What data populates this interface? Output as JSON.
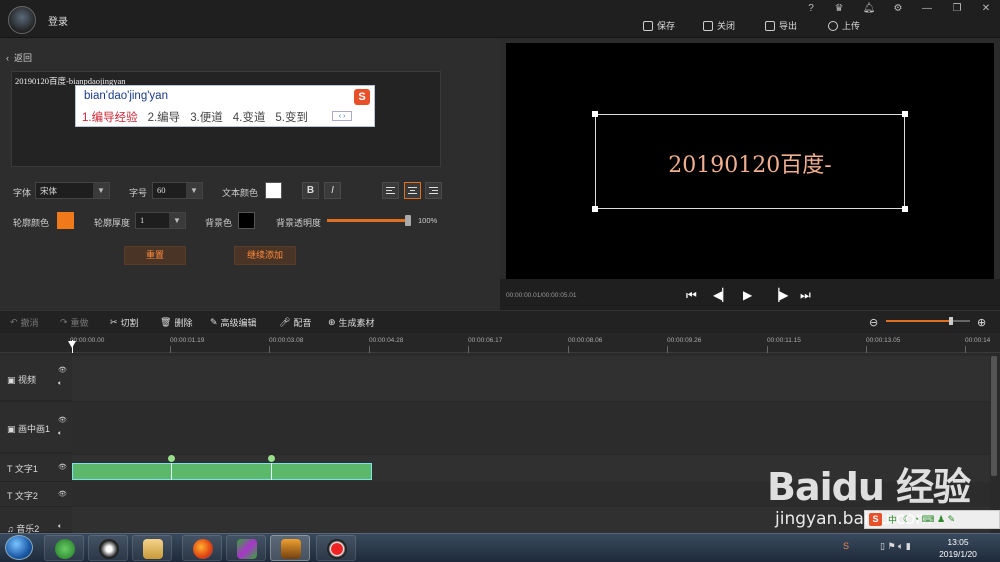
{
  "topbar": {
    "login": "登录",
    "actions": [
      {
        "label": "保存",
        "icon": "save-icon"
      },
      {
        "label": "关闭",
        "icon": "close-icon"
      },
      {
        "label": "导出",
        "icon": "export-icon"
      },
      {
        "label": "上传",
        "icon": "upload-icon"
      }
    ],
    "window_icons": [
      "help-icon",
      "vip-icon",
      "bell-icon",
      "gear-icon",
      "minimize-icon",
      "restore-icon",
      "close-window-icon"
    ],
    "help_glyph": "?"
  },
  "editor": {
    "back_label": "返回",
    "text_value": "20190120百度-bianpdaojingyan",
    "ime": {
      "pinyin": "bian'dao'jing'yan",
      "candidates": [
        "1.编导经验",
        "2.编导",
        "3.便道",
        "4.变道",
        "5.变到"
      ],
      "logo": "S"
    },
    "font_label": "字体",
    "font_value": "宋体",
    "size_label": "字号",
    "size_value": "60",
    "text_color_label": "文本颜色",
    "text_color": "#ffffff",
    "bold": "B",
    "italic": "I",
    "outline_color_label": "轮廓颜色",
    "outline_color": "#f07a1a",
    "outline_width_label": "轮廓厚度",
    "outline_width_value": "1",
    "bg_color_label": "背景色",
    "bg_color": "#000000",
    "bg_opacity_label": "背景透明度",
    "bg_opacity_value": "100%",
    "bg_opacity": 1.0,
    "reset_label": "重置",
    "continue_label": "继续添加",
    "accent": "#e07020"
  },
  "preview": {
    "text": "20190120百度-",
    "time": "00:00:00.01/00:00:05.01"
  },
  "toolbar": {
    "undo": "撤消",
    "redo": "重做",
    "cut": "切割",
    "delete": "删除",
    "advanced": "高级编辑",
    "dub": "配音",
    "generate": "生成素材"
  },
  "ruler_ticks": [
    "00:00:00.00",
    "00:00:01.19",
    "00:00:03.08",
    "00:00:04.28",
    "00:00:06.17",
    "00:00:08.06",
    "00:00:09.26",
    "00:00:11.15",
    "00:00:13.05",
    "00:00:14"
  ],
  "tracks": [
    {
      "name": "视频",
      "icon": "video-icon"
    },
    {
      "name": "画中画1",
      "icon": "pip-icon"
    },
    {
      "name": "文字1",
      "icon": "text-icon"
    },
    {
      "name": "文字2",
      "icon": "text-icon"
    },
    {
      "name": "音乐2",
      "icon": "music-icon"
    }
  ],
  "clip": {
    "color": "#5cb86a"
  },
  "taskbar": {
    "apps": [
      "green-app-icon",
      "qq-icon",
      "explorer-icon",
      "firefox-icon",
      "media-icon",
      "video-editor-icon",
      "record-icon"
    ],
    "time": "13:05",
    "date": "2019/1/20",
    "ime_logo": "S",
    "ime_mode": "中"
  },
  "watermark": {
    "brand": "Baidu 经验",
    "url": "jingyan.baidu.com"
  }
}
